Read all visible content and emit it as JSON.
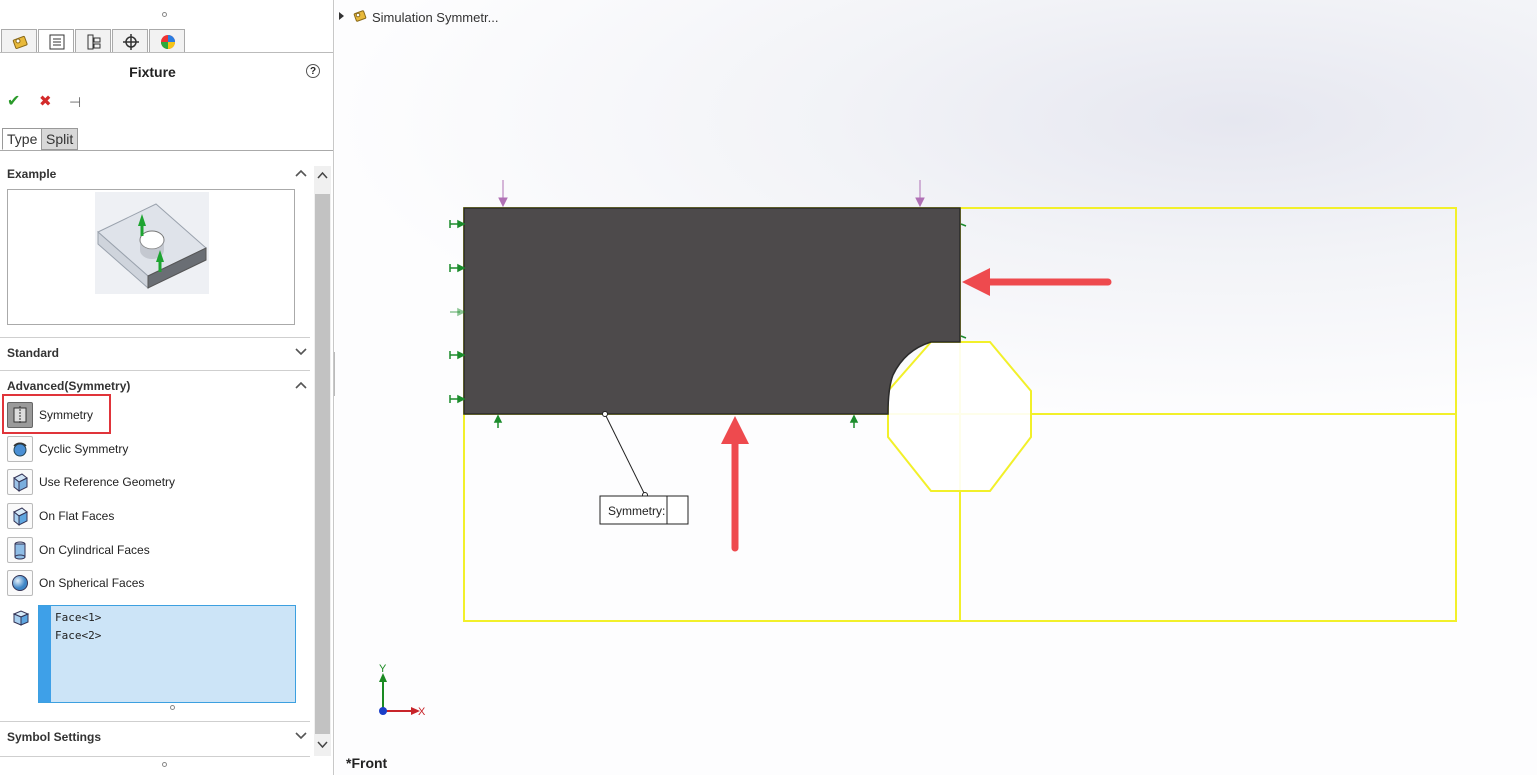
{
  "panel": {
    "tabs": [
      {
        "icon": "simulation-fixture-icon",
        "active": false
      },
      {
        "icon": "property-manager-icon",
        "active": true
      },
      {
        "icon": "configuration-manager-icon",
        "active": false
      },
      {
        "icon": "dimxpert-icon",
        "active": false
      },
      {
        "icon": "display-manager-icon",
        "active": false
      }
    ],
    "title": "Fixture",
    "help_icon": "?",
    "actions": {
      "ok": "✔",
      "cancel": "✖",
      "pin": "⊣"
    },
    "subtabs": [
      "Type",
      "Split"
    ],
    "sections": {
      "example": "Example",
      "standard": "Standard",
      "advanced": "Advanced(Symmetry)",
      "symbol_settings": "Symbol Settings"
    },
    "options": [
      {
        "label": "Symmetry",
        "icon": "symmetry-icon",
        "selected": true
      },
      {
        "label": "Cyclic Symmetry",
        "icon": "cyclic-symmetry-icon",
        "selected": false
      },
      {
        "label": "Use Reference Geometry",
        "icon": "reference-geometry-icon",
        "selected": false
      },
      {
        "label": "On Flat Faces",
        "icon": "flat-faces-icon",
        "selected": false
      },
      {
        "label": "On Cylindrical Faces",
        "icon": "cylindrical-faces-icon",
        "selected": false
      },
      {
        "label": "On Spherical Faces",
        "icon": "spherical-faces-icon",
        "selected": false
      }
    ],
    "faces": [
      "Face<1>",
      "Face<2>"
    ]
  },
  "viewport": {
    "tree_item": "Simulation Symmetr...",
    "callout": "Symmetry:",
    "view_name": "*Front",
    "axis": {
      "x": "X",
      "y": "Y"
    }
  },
  "colors": {
    "highlight": "#e0343a",
    "arrow": "#ee4a4e",
    "model": "#4d4a4b",
    "edge": "#f2f02a",
    "fixture": "#1c8c2c",
    "selection": "#cce4f7"
  }
}
